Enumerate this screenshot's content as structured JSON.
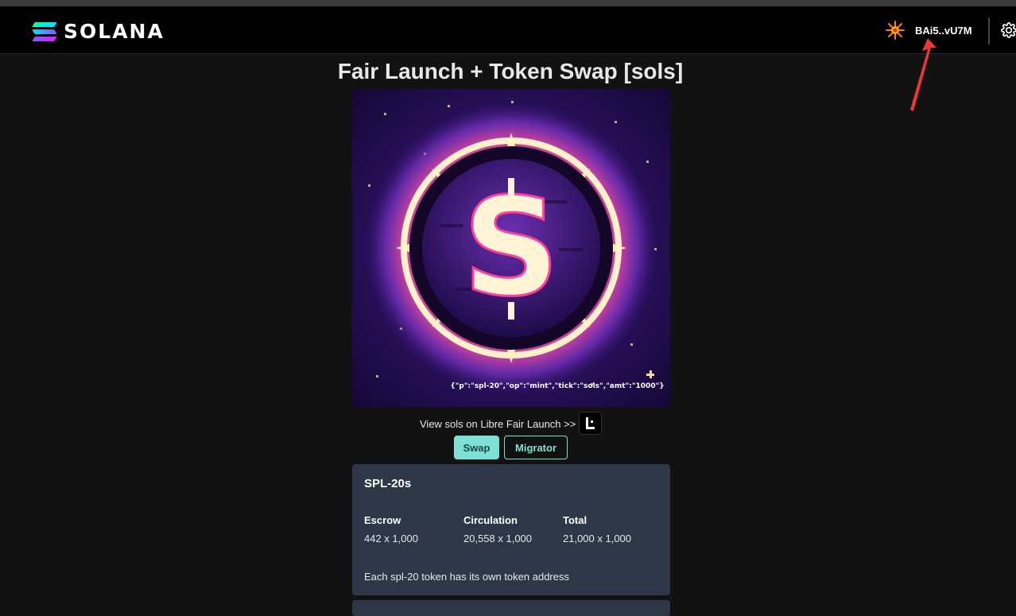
{
  "brand": {
    "name": "SOLANA"
  },
  "wallet": {
    "address": "BAi5..vU7M"
  },
  "page": {
    "title": "Fair Launch + Token Swap [sols]"
  },
  "artwork": {
    "inscription": "{\"p\":\"spl-20\",\"op\":\"mint\",\"tick\":\"sols\",\"amt\":\"1000\"}"
  },
  "links": {
    "view_libre": "View sols on Libre Fair Launch >>"
  },
  "tabs": {
    "swap": "Swap",
    "migrator": "Migrator"
  },
  "card": {
    "title": "SPL-20s",
    "stats": [
      {
        "label": "Escrow",
        "value": "442 x 1,000"
      },
      {
        "label": "Circulation",
        "value": "20,558 x 1,000"
      },
      {
        "label": "Total",
        "value": "21,000 x 1,000"
      }
    ],
    "note": "Each spl-20 token has its own token address"
  },
  "colors": {
    "accent": "#7ee0d2",
    "card_bg": "#2d3748",
    "page_bg": "#121212",
    "annotation": "#e53935"
  }
}
